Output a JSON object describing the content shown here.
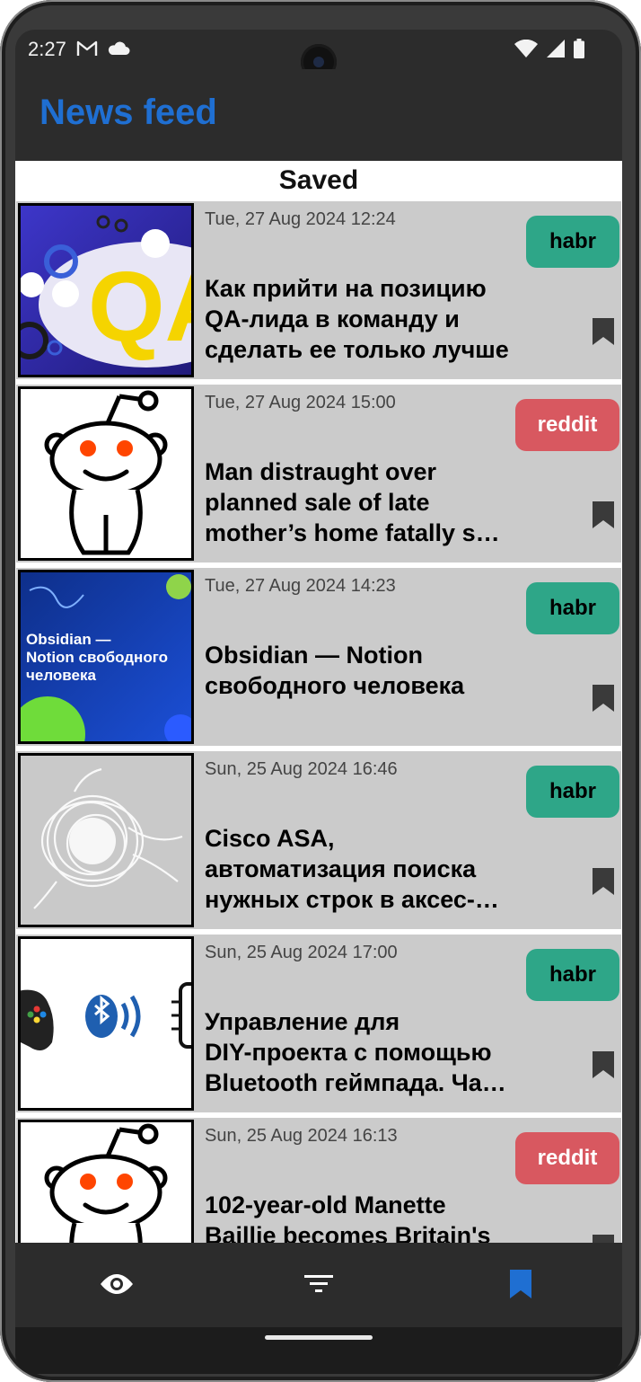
{
  "status_bar": {
    "time": "2:27"
  },
  "app_bar": {
    "title": "News feed",
    "title_color": "#1f6fd2"
  },
  "section": {
    "title": "Saved"
  },
  "articles": [
    {
      "date": "Tue, 27 Aug 2024 12:24",
      "title_lines": [
        "Как прийти на позицию",
        "QA-лида в команду и",
        "сделать ее только лучше"
      ],
      "source": "habr",
      "thumbnail": "qa-illustration",
      "saved": true
    },
    {
      "date": "Tue, 27 Aug 2024 15:00",
      "title_lines": [
        "Man distraught over",
        "planned sale of late",
        "mother’s home fatally s…"
      ],
      "source": "reddit",
      "thumbnail": "reddit-mascot",
      "saved": true
    },
    {
      "date": "Tue, 27 Aug 2024 14:23",
      "title_lines": [
        "Obsidian — Notion",
        "свободного человека"
      ],
      "source": "habr",
      "thumbnail": "obsidian-notion-banner",
      "thumbnail_text": [
        "Obsidian —",
        "Notion свободного",
        "человека"
      ],
      "saved": true
    },
    {
      "date": "Sun, 25 Aug 2024 16:46",
      "title_lines": [
        "Cisco ASA,",
        "автоматизация поиска",
        "нужных строк в аксес-…"
      ],
      "source": "habr",
      "thumbnail": "white-scribble",
      "saved": true
    },
    {
      "date": "Sun, 25 Aug 2024 17:00",
      "title_lines": [
        "Управление для",
        "DIY-проекта с помощью",
        "Bluetooth геймпада. Ча…"
      ],
      "source": "habr",
      "thumbnail": "gamepad-bluetooth",
      "saved": true
    },
    {
      "date": "Sun, 25 Aug 2024 16:13",
      "title_lines": [
        "102-year-old Manette",
        "Baillie becomes Britain's"
      ],
      "source": "reddit",
      "thumbnail": "reddit-mascot",
      "saved": true
    }
  ],
  "bottom_nav": {
    "items": [
      {
        "icon": "eye-icon",
        "active": false
      },
      {
        "icon": "filter-icon",
        "active": false
      },
      {
        "icon": "bookmark-icon",
        "active": true
      }
    ],
    "active_color": "#1f6fd2"
  }
}
